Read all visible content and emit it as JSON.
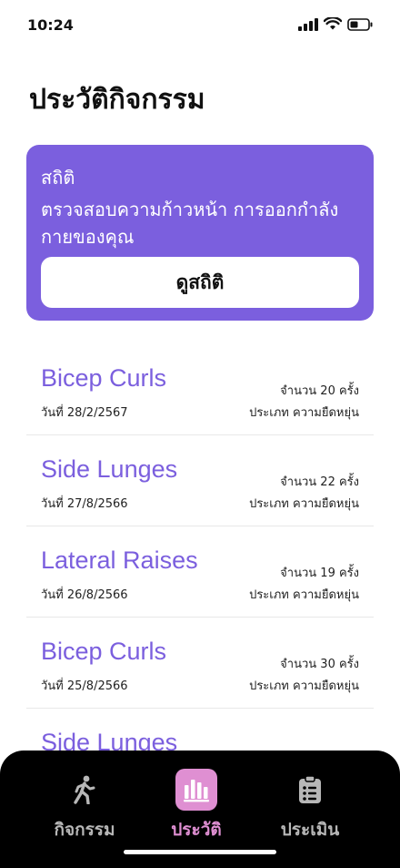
{
  "status": {
    "time": "10:24",
    "icons": [
      "signal-icon",
      "wifi-icon",
      "battery-icon"
    ]
  },
  "page": {
    "title": "ประวัติกิจกรรม"
  },
  "stats_card": {
    "title": "สถิติ",
    "description": "ตรวจสอบความก้าวหน้า การออกกำลังกายของคุณ",
    "button_label": "ดูสถิติ"
  },
  "history": [
    {
      "name": "Bicep Curls",
      "date": "วันที่ 28/2/2567",
      "count": "จำนวน 20 ครั้ง",
      "type": "ประเภท ความยืดหยุ่น"
    },
    {
      "name": "Side Lunges",
      "date": "วันที่ 27/8/2566",
      "count": "จำนวน 22 ครั้ง",
      "type": "ประเภท ความยืดหยุ่น"
    },
    {
      "name": "Lateral Raises",
      "date": "วันที่ 26/8/2566",
      "count": "จำนวน 19 ครั้ง",
      "type": "ประเภท ความยืดหยุ่น"
    },
    {
      "name": "Bicep Curls",
      "date": "วันที่ 25/8/2566",
      "count": "จำนวน 30 ครั้ง",
      "type": "ประเภท ความยืดหยุ่น"
    },
    {
      "name": "Side Lunges",
      "date": "",
      "count": "",
      "type": ""
    }
  ],
  "tabs": [
    {
      "label": "กิจกรรม",
      "icon": "walking-icon",
      "active": false
    },
    {
      "label": "ประวัติ",
      "icon": "bar-chart-icon",
      "active": true
    },
    {
      "label": "ประเมิน",
      "icon": "clipboard-icon",
      "active": false
    }
  ],
  "colors": {
    "accent": "#7b5fde",
    "active_tab": "#df8fd2",
    "tab_bar": "#000000"
  }
}
